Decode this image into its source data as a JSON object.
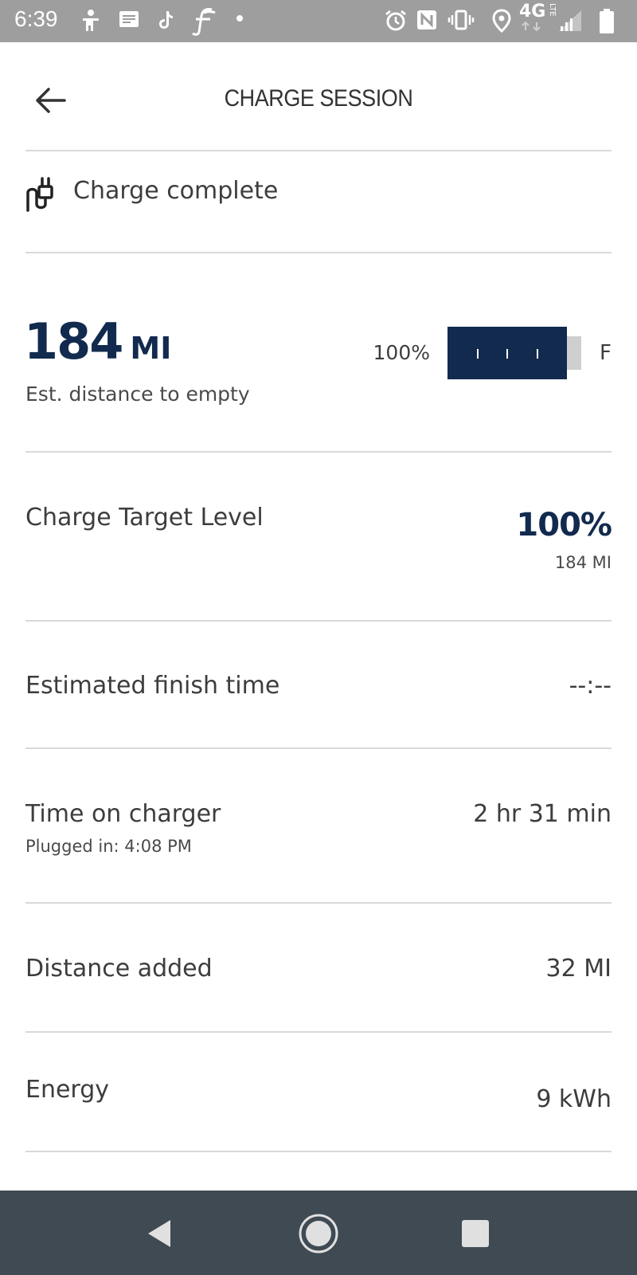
{
  "status_bar": {
    "time": "6:39",
    "network": "4G",
    "network_sub": "LTE",
    "icons": [
      "accessibility-icon",
      "message-icon",
      "tiktok-icon",
      "app-f-icon",
      "notification-dot-icon",
      "alarm-icon",
      "nfc-icon",
      "vibrate-icon",
      "location-icon",
      "network-4g-icon",
      "signal-icon",
      "battery-icon"
    ]
  },
  "header": {
    "title": "CHARGE SESSION",
    "back_icon": "arrow-left-icon"
  },
  "charge_status": {
    "icon": "plug-icon",
    "label": "Charge complete"
  },
  "range": {
    "value": "184",
    "unit": "MI",
    "label": "Est. distance to empty",
    "battery_percent_text": "100%",
    "battery_level": 1.0,
    "full_label": "F"
  },
  "rows": {
    "charge_target": {
      "label": "Charge Target Level",
      "value": "100%",
      "sub_value": "184 MI"
    },
    "finish_time": {
      "label": "Estimated finish time",
      "value": "--:--"
    },
    "time_on_charger": {
      "label": "Time on charger",
      "sub_label": "Plugged in: 4:08 PM",
      "value": "2 hr 31 min"
    },
    "distance_added": {
      "label": "Distance added",
      "value": "32 MI"
    },
    "energy": {
      "label": "Energy",
      "value": "9 kWh"
    }
  },
  "colors": {
    "accent": "#122a4e",
    "status_bar": "#9e9e9e",
    "nav_bar": "#3f4a53",
    "divider": "#d9d9d9"
  },
  "nav_bar": {
    "icons": [
      "nav-back-icon",
      "nav-home-icon",
      "nav-recents-icon"
    ]
  }
}
